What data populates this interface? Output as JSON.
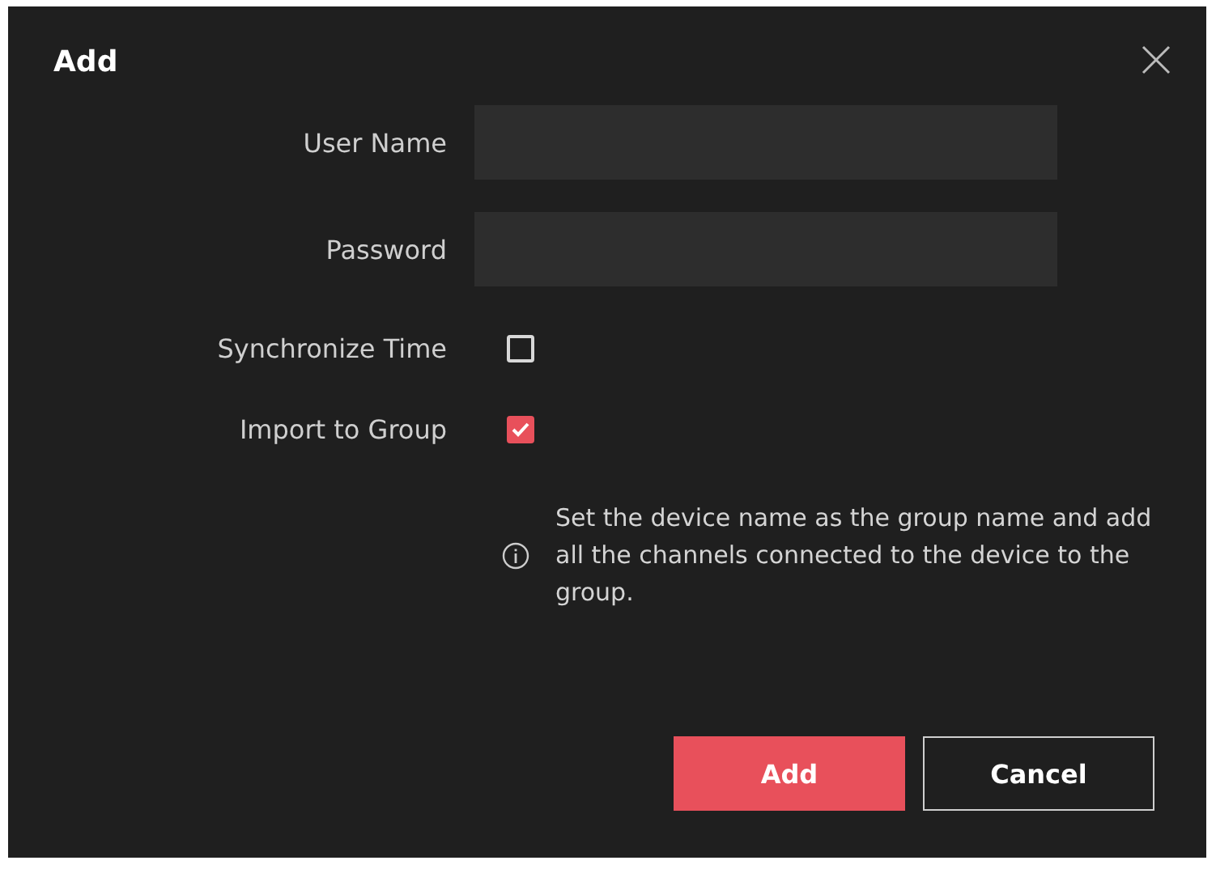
{
  "dialog": {
    "title": "Add"
  },
  "fields": [
    {
      "label": "User Name"
    },
    {
      "label": "Password"
    }
  ],
  "checkboxes": [
    {
      "label": "Synchronize Time",
      "checked": false
    },
    {
      "label": "Import to Group",
      "checked": true
    }
  ],
  "info": "Set the device name as the group name and add all the channels connected to the device to the group.",
  "buttons": [
    {
      "label": "Add",
      "kind": "primary"
    },
    {
      "label": "Cancel",
      "kind": "secondary"
    }
  ]
}
